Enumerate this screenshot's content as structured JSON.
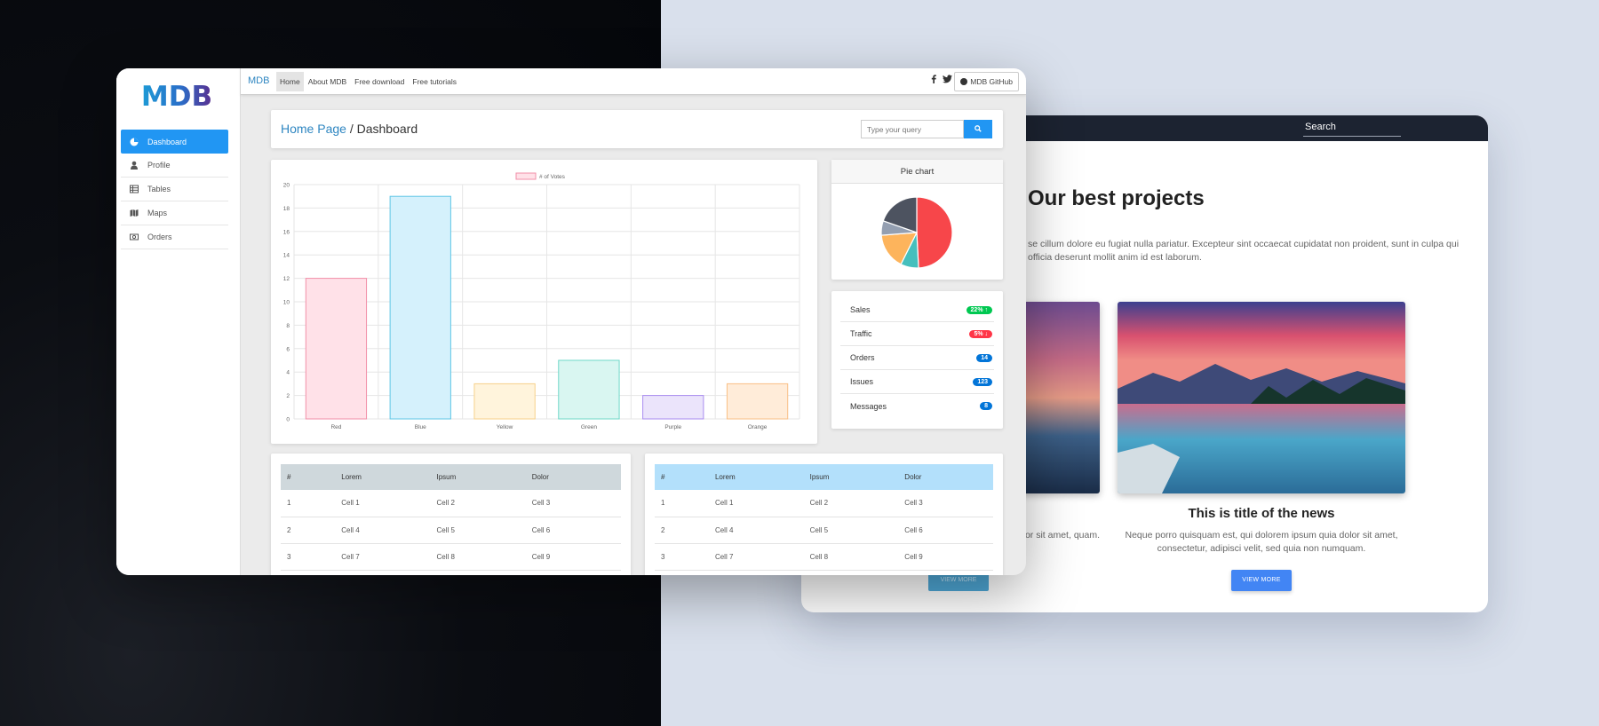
{
  "back_window": {
    "search_label": "Search",
    "title": "Our best projects",
    "paragraph": "se cillum dolore eu fugiat nulla pariatur. Excepteur sint occaecat cupidatat non proident, sunt in culpa qui officia deserunt mollit anim id est laborum.",
    "news_title": "This is title of the news",
    "news_text": "Neque porro quisquam est, qui dolorem ipsum quia dolor sit amet, consectetur, adipisci velit, sed quia non numquam.",
    "news_text_left": "dolor sit amet, quam.",
    "view_more": "VIEW MORE",
    "view_more_left": "VIEW MORE"
  },
  "sidebar": {
    "logo": "MDB",
    "items": [
      {
        "label": "Dashboard",
        "icon": "pie-chart-icon",
        "active": true
      },
      {
        "label": "Profile",
        "icon": "user-icon",
        "active": false
      },
      {
        "label": "Tables",
        "icon": "table-icon",
        "active": false
      },
      {
        "label": "Maps",
        "icon": "map-icon",
        "active": false
      },
      {
        "label": "Orders",
        "icon": "money-icon",
        "active": false
      }
    ]
  },
  "topnav": {
    "brand": "MDB",
    "links": [
      "Home",
      "About MDB",
      "Free download",
      "Free tutorials"
    ],
    "github_label": "MDB GitHub"
  },
  "breadcrumb": {
    "home": "Home Page",
    "separator": " / ",
    "current": "Dashboard"
  },
  "search": {
    "placeholder": "Type your query"
  },
  "pie_card": {
    "title": "Pie chart"
  },
  "chart_data": [
    {
      "type": "bar",
      "categories": [
        "Red",
        "Blue",
        "Yellow",
        "Green",
        "Purple",
        "Orange"
      ],
      "series": [
        {
          "name": "# of Votes",
          "values": [
            12,
            19,
            3,
            5,
            2,
            3
          ]
        }
      ],
      "ylim": [
        0,
        20
      ],
      "yticks": [
        0,
        2,
        4,
        6,
        8,
        10,
        12,
        14,
        16,
        18,
        20
      ],
      "grid": true,
      "legend": "top-center",
      "fill_colors": [
        "#ffe1e8",
        "#d5f1fc",
        "#fff4dc",
        "#d9f6f1",
        "#ebe4fb",
        "#ffecd9"
      ],
      "stroke_colors": [
        "#f28fa8",
        "#5ec6e6",
        "#f7d18a",
        "#6ed8c8",
        "#a98df0",
        "#f9bf85"
      ]
    },
    {
      "type": "pie",
      "values": [
        300,
        50,
        100,
        40,
        120
      ],
      "colors": [
        "#f7464a",
        "#46bfbd",
        "#fdb45c",
        "#949fb1",
        "#4d5360"
      ]
    }
  ],
  "stats": [
    {
      "label": "Sales",
      "badge": "22%",
      "arrow": "up",
      "color": "#00c851"
    },
    {
      "label": "Traffic",
      "badge": "5%",
      "arrow": "down",
      "color": "#ff3547"
    },
    {
      "label": "Orders",
      "badge": "14",
      "arrow": "",
      "color": "#0275d8"
    },
    {
      "label": "Issues",
      "badge": "123",
      "arrow": "",
      "color": "#0275d8"
    },
    {
      "label": "Messages",
      "badge": "8",
      "arrow": "",
      "color": "#0275d8"
    }
  ],
  "tables": [
    {
      "header_color": "#cfd8dc",
      "headers": [
        "#",
        "Lorem",
        "Ipsum",
        "Dolor"
      ],
      "rows": [
        [
          "1",
          "Cell 1",
          "Cell 2",
          "Cell 3"
        ],
        [
          "2",
          "Cell 4",
          "Cell 5",
          "Cell 6"
        ],
        [
          "3",
          "Cell 7",
          "Cell 8",
          "Cell 9"
        ]
      ]
    },
    {
      "header_color": "#b3e0fb",
      "headers": [
        "#",
        "Lorem",
        "Ipsum",
        "Dolor"
      ],
      "rows": [
        [
          "1",
          "Cell 1",
          "Cell 2",
          "Cell 3"
        ],
        [
          "2",
          "Cell 4",
          "Cell 5",
          "Cell 6"
        ],
        [
          "3",
          "Cell 7",
          "Cell 8",
          "Cell 9"
        ]
      ]
    }
  ]
}
